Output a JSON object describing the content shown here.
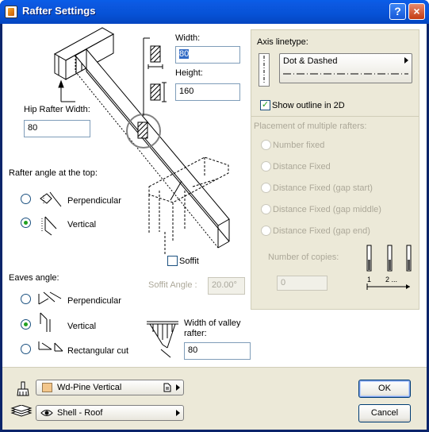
{
  "window": {
    "title": "Rafter Settings",
    "help_glyph": "?",
    "close_glyph": "×"
  },
  "left": {
    "width_label": "Width:",
    "width_value": "80",
    "height_label": "Height:",
    "height_value": "160",
    "hip_width_label": "Hip Rafter Width:",
    "hip_width_value": "80",
    "rafter_angle_label": "Rafter angle at the top:",
    "top_options": [
      {
        "label": "Perpendicular",
        "checked": false
      },
      {
        "label": "Vertical",
        "checked": true
      }
    ],
    "soffit_label": "Soffit",
    "soffit_checked": false,
    "soffit_angle_label": "Soffit Angle :",
    "soffit_angle_value": "20.00°",
    "eaves_label": "Eaves angle:",
    "eaves_options": [
      {
        "label": "Perpendicular",
        "checked": false
      },
      {
        "label": "Vertical",
        "checked": true
      },
      {
        "label": "Rectangular cut",
        "checked": false
      }
    ],
    "valley_label_1": "Width of valley",
    "valley_label_2": "rafter:",
    "valley_value": "80"
  },
  "right": {
    "axis_label": "Axis linetype:",
    "axis_value": "Dot & Dashed",
    "show_outline_label": "Show outline in 2D",
    "show_outline_checked": true,
    "placement_label": "Placement of multiple rafters:",
    "placement_options": [
      "Number fixed",
      "Distance Fixed",
      "Distance Fixed (gap start)",
      "Distance Fixed (gap middle)",
      "Distance Fixed (gap end)"
    ],
    "copies_label": "Number of copies:",
    "copies_value": "0",
    "copies_markers": [
      "1",
      "2 ..."
    ]
  },
  "bottom": {
    "material_value": "Wd-Pine Vertical",
    "material_swatch": "#f3c68b",
    "layer_value": "Shell - Roof",
    "ok_label": "OK",
    "cancel_label": "Cancel"
  },
  "colors": {
    "title_bar": "#0a5ee8",
    "dialog_bg": "#ece9d8",
    "selection": "#316ac5",
    "radio_dot": "#21a121"
  }
}
